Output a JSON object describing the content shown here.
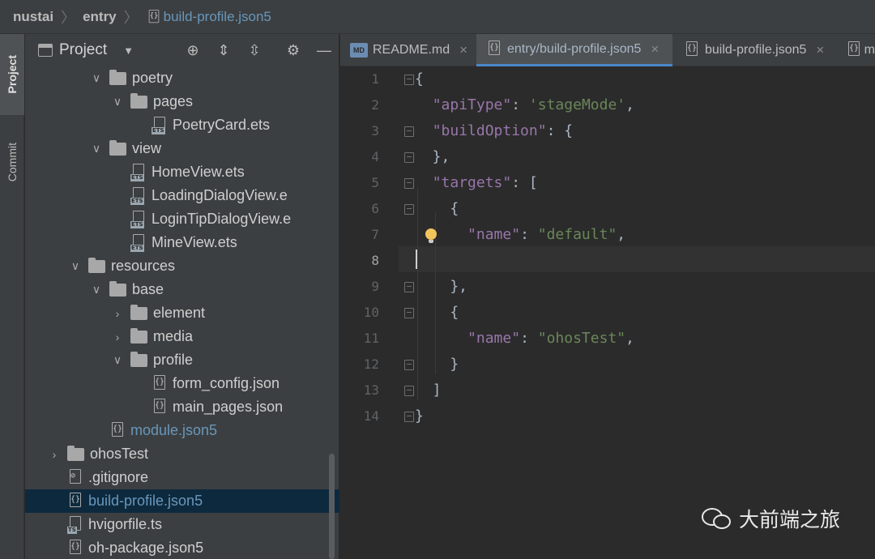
{
  "breadcrumb": {
    "project": "nustai",
    "module": "entry",
    "file": "build-profile.json5"
  },
  "left_stripe": {
    "project_label": "Project",
    "commit_label": "Commit"
  },
  "project_panel": {
    "title": "Project",
    "tree": [
      {
        "label": "poetry",
        "kind": "folder",
        "depth": 5,
        "expanded": true
      },
      {
        "label": "pages",
        "kind": "folder",
        "depth": 6,
        "expanded": true
      },
      {
        "label": "PoetryCard.ets",
        "kind": "ets",
        "depth": 7
      },
      {
        "label": "view",
        "kind": "folder",
        "depth": 5,
        "expanded": true
      },
      {
        "label": "HomeView.ets",
        "kind": "ets",
        "depth": 6
      },
      {
        "label": "LoadingDialogView.e",
        "kind": "ets",
        "depth": 6
      },
      {
        "label": "LoginTipDialogView.e",
        "kind": "ets",
        "depth": 6
      },
      {
        "label": "MineView.ets",
        "kind": "ets",
        "depth": 6
      },
      {
        "label": "resources",
        "kind": "folder",
        "depth": 4,
        "expanded": true
      },
      {
        "label": "base",
        "kind": "folder",
        "depth": 5,
        "expanded": true
      },
      {
        "label": "element",
        "kind": "folder",
        "depth": 6,
        "expanded": false
      },
      {
        "label": "media",
        "kind": "folder",
        "depth": 6,
        "expanded": false
      },
      {
        "label": "profile",
        "kind": "folder",
        "depth": 6,
        "expanded": true
      },
      {
        "label": "form_config.json",
        "kind": "json",
        "depth": 7
      },
      {
        "label": "main_pages.json",
        "kind": "json",
        "depth": 7
      },
      {
        "label": "module.json5",
        "kind": "json",
        "depth": 5,
        "blue": true
      },
      {
        "label": "ohosTest",
        "kind": "folder",
        "depth": 3,
        "expanded": false
      },
      {
        "label": ".gitignore",
        "kind": "ignore",
        "depth": 3
      },
      {
        "label": "build-profile.json5",
        "kind": "json",
        "depth": 3,
        "blue": true,
        "selected": true
      },
      {
        "label": "hvigorfile.ts",
        "kind": "ts",
        "depth": 3
      },
      {
        "label": "oh-package.json5",
        "kind": "json",
        "depth": 3
      }
    ]
  },
  "tabs": [
    {
      "label": "README.md",
      "icon": "markdown-icon",
      "active": false
    },
    {
      "label": "entry/build-profile.json5",
      "icon": "json-file-icon",
      "active": true
    },
    {
      "label": "build-profile.json5",
      "icon": "json-file-icon",
      "active": false
    },
    {
      "label": "m",
      "icon": "json-file-icon",
      "active": false
    }
  ],
  "editor": {
    "current_line": 8,
    "lines": [
      "1",
      "2",
      "3",
      "4",
      "5",
      "6",
      "7",
      "8",
      "9",
      "10",
      "11",
      "12",
      "13",
      "14"
    ],
    "tokens": {
      "open_brace": "{",
      "apiType_key": "\"apiType\"",
      "apiType_value": "'stageMode'",
      "buildOption_key": "\"buildOption\"",
      "targets_key": "\"targets\"",
      "name_key": "\"name\"",
      "default_value": "\"default\"",
      "ohosTest_value": "\"ohosTest\""
    }
  },
  "watermark": {
    "text": "大前端之旅",
    "icon": "wechat-icon"
  }
}
